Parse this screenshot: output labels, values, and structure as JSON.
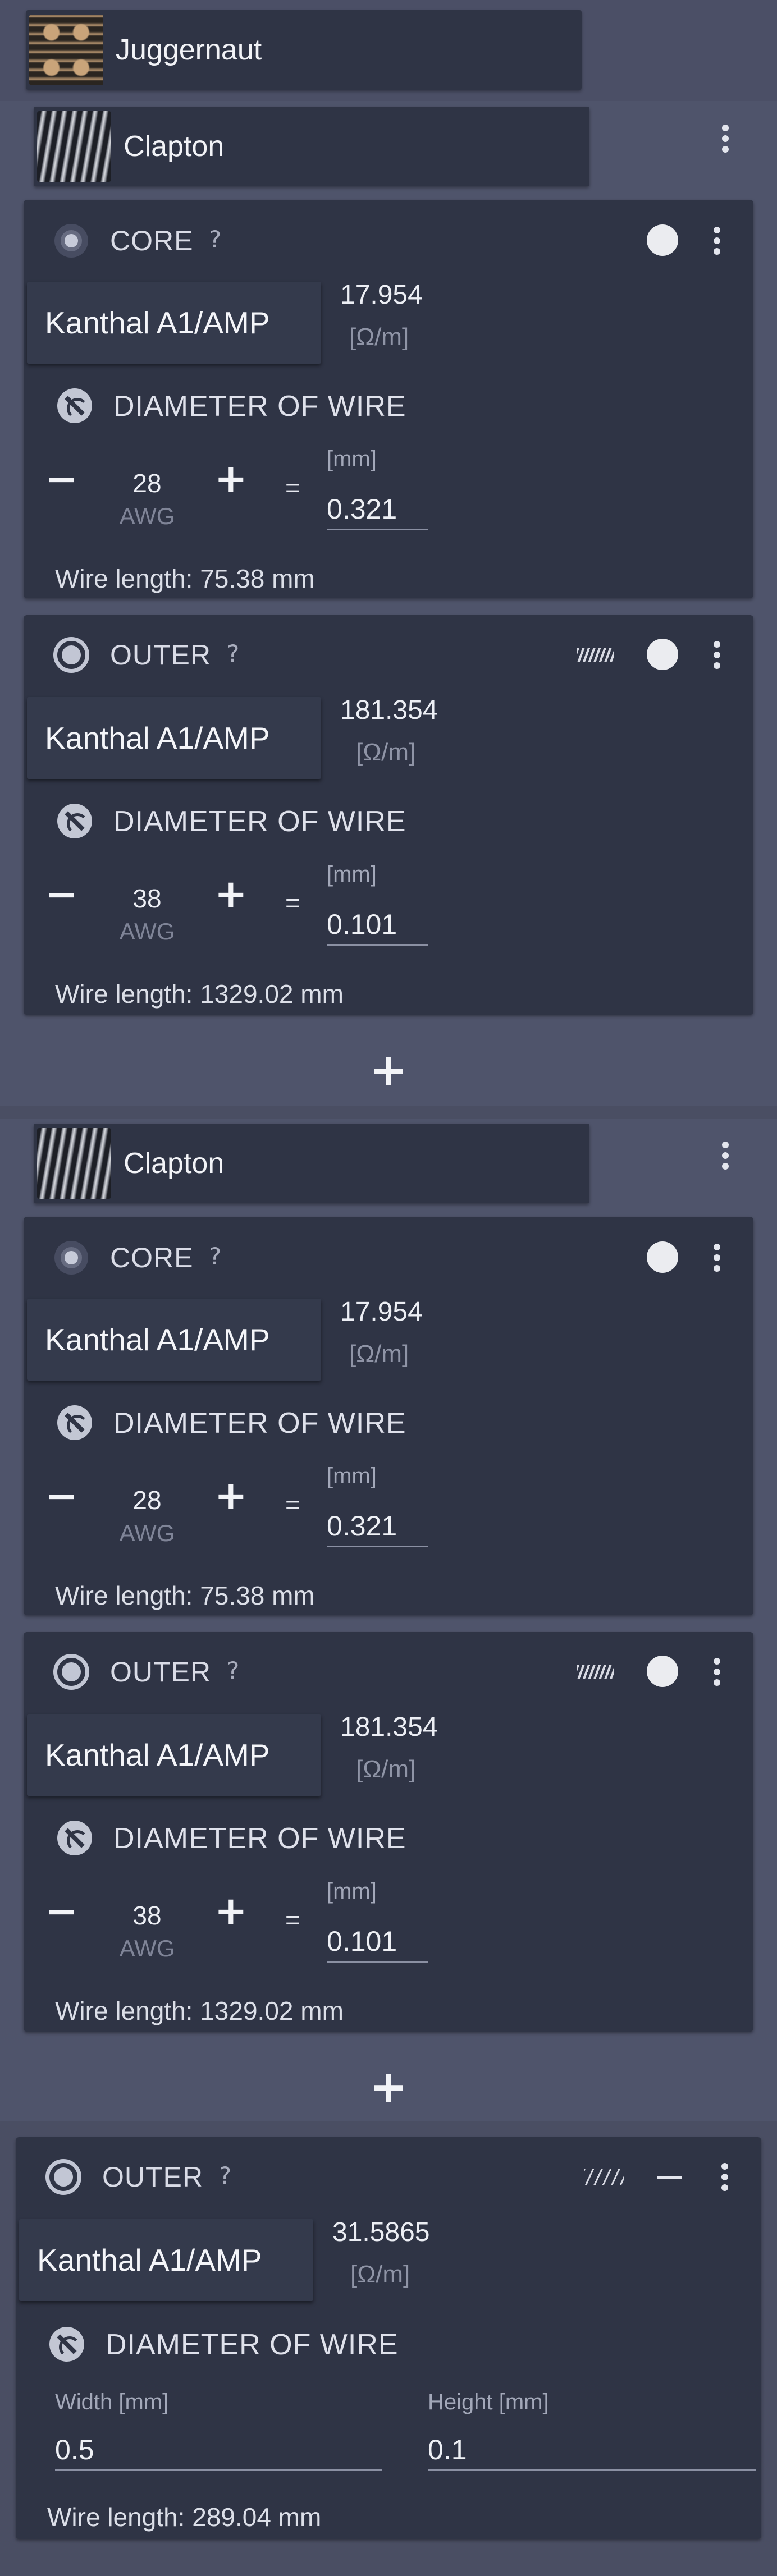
{
  "juggernaut": {
    "title": "Juggernaut",
    "thumb_icon": "juggernaut-coil-thumbnail"
  },
  "clapton1": {
    "title": "Clapton",
    "core": {
      "label": "CORE",
      "help": "?",
      "material": "Kanthal A1/AMP",
      "resistance": "17.954",
      "resistance_unit": "[Ω/m]",
      "diameter_title": "DIAMETER OF WIRE",
      "awg": "28",
      "awg_label": "AWG",
      "mm_label": "[mm]",
      "mm_value": "0.321",
      "wire_length": "Wire length: 75.38 mm"
    },
    "outer": {
      "label": "OUTER",
      "help": "?",
      "material": "Kanthal A1/AMP",
      "resistance": "181.354",
      "resistance_unit": "[Ω/m]",
      "diameter_title": "DIAMETER OF WIRE",
      "awg": "38",
      "awg_label": "AWG",
      "mm_label": "[mm]",
      "mm_value": "0.101",
      "wire_length": "Wire length: 1329.02 mm"
    },
    "add_label": "+"
  },
  "clapton2": {
    "title": "Clapton",
    "core": {
      "label": "CORE",
      "help": "?",
      "material": "Kanthal A1/AMP",
      "resistance": "17.954",
      "resistance_unit": "[Ω/m]",
      "diameter_title": "DIAMETER OF WIRE",
      "awg": "28",
      "awg_label": "AWG",
      "mm_label": "[mm]",
      "mm_value": "0.321",
      "wire_length": "Wire length: 75.38 mm"
    },
    "outer": {
      "label": "OUTER",
      "help": "?",
      "material": "Kanthal A1/AMP",
      "resistance": "181.354",
      "resistance_unit": "[Ω/m]",
      "diameter_title": "DIAMETER OF WIRE",
      "awg": "38",
      "awg_label": "AWG",
      "mm_label": "[mm]",
      "mm_value": "0.101",
      "wire_length": "Wire length: 1329.02 mm"
    },
    "add_label": "+"
  },
  "outer3": {
    "label": "OUTER",
    "help": "?",
    "material": "Kanthal A1/AMP",
    "resistance": "31.5865",
    "resistance_unit": "[Ω/m]",
    "diameter_title": "DIAMETER OF WIRE",
    "width_label": "Width [mm]",
    "width_value": "0.5",
    "height_label": "Height [mm]",
    "height_value": "0.1",
    "wire_length": "Wire length: 289.04 mm"
  },
  "controls": {
    "minus": "−",
    "plus": "+",
    "equals": "="
  },
  "colors": {
    "background": "#4a4e63",
    "card": "#2f3445",
    "accent_text": "#e8eaf2"
  }
}
